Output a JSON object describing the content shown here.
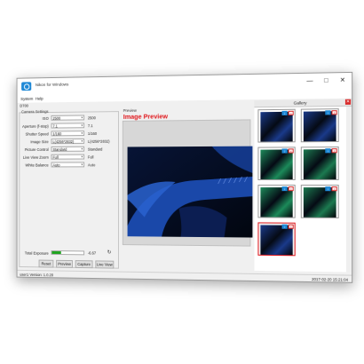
{
  "window": {
    "title": "Nikon for Windows",
    "controls": {
      "minimize": "—",
      "maximize": "□",
      "close": "✕"
    }
  },
  "menu": {
    "items": [
      "System",
      "Help"
    ]
  },
  "camera_model": "D700",
  "camera_settings": {
    "title": "Camera Settings",
    "rows": [
      {
        "label": "ISO",
        "selected": "2500",
        "value": "2500"
      },
      {
        "label": "Aperture (f-stop)",
        "selected": "7.1",
        "value": "7.1"
      },
      {
        "label": "Shutter Speed",
        "selected": "1/160",
        "value": "1/160"
      },
      {
        "label": "Image Size",
        "selected": "L(4256*2832)",
        "value": "L(4256*2832)"
      },
      {
        "label": "Picture Control",
        "selected": "Standard",
        "value": "Standard"
      },
      {
        "label": "Live View Zoom",
        "selected": "Full",
        "value": "Full"
      },
      {
        "label": "White Balance",
        "selected": "Auto",
        "value": "Auto"
      }
    ],
    "exposure": {
      "label": "Total Exposure",
      "fill_fraction": 0.3,
      "value": "-6.67"
    },
    "buttons": [
      "Reset",
      "Preview",
      "Capture",
      "Live View"
    ]
  },
  "preview": {
    "caption": "Preview",
    "heading": "Image Preview"
  },
  "gallery": {
    "title": "Gallery",
    "close_glyph": "✕",
    "thumbnail_count": 7,
    "thumbnail_tints": [
      "#1a3a8a",
      "#1a3a8a",
      "#1c8a5a",
      "#1c7a50",
      "#1c8a5a",
      "#1c7a50",
      "#1a3a8a"
    ],
    "selected_index": 6
  },
  "status": {
    "left": "user1 Version: 1.0.20",
    "right": "2017-02-20 15:21:04"
  },
  "colors": {
    "accent": "#1e88d6",
    "heading_red": "#e0161b",
    "exposure_green": "#1fa51f"
  }
}
